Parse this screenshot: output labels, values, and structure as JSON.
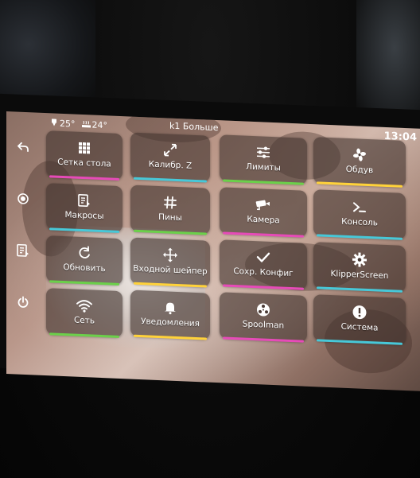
{
  "status": {
    "extruder_temp": "25°",
    "bed_temp": "24°",
    "title": "k1 Больше",
    "time": "13:04"
  },
  "colors": {
    "cyan": "#47c8d8",
    "green": "#6bd04a",
    "yellow": "#ffd23a",
    "magenta": "#e64bb8"
  },
  "sidebar": [
    {
      "name": "back-icon",
      "icon": "back"
    },
    {
      "name": "home-icon",
      "icon": "home"
    },
    {
      "name": "macro-shortcut-icon",
      "icon": "macro"
    },
    {
      "name": "power-icon",
      "icon": "power"
    }
  ],
  "tiles": [
    {
      "label": "Сетка стола",
      "icon": "grid",
      "color": "magenta"
    },
    {
      "label": "Калибр. Z",
      "icon": "z-calibrate",
      "color": "cyan"
    },
    {
      "label": "Лимиты",
      "icon": "sliders",
      "color": "green"
    },
    {
      "label": "Обдув",
      "icon": "fan",
      "color": "yellow"
    },
    {
      "label": "Макросы",
      "icon": "macro",
      "color": "cyan"
    },
    {
      "label": "Пины",
      "icon": "hash",
      "color": "green"
    },
    {
      "label": "Камера",
      "icon": "camera",
      "color": "magenta"
    },
    {
      "label": "Консоль",
      "icon": "console",
      "color": "cyan"
    },
    {
      "label": "Обновить",
      "icon": "refresh",
      "color": "green"
    },
    {
      "label": "Входной шейпер",
      "icon": "move",
      "color": "yellow"
    },
    {
      "label": "Сохр. Конфиг",
      "icon": "check",
      "color": "magenta"
    },
    {
      "label": "KlipperScreen",
      "icon": "gear",
      "color": "cyan"
    },
    {
      "label": "Сеть",
      "icon": "wifi",
      "color": "green"
    },
    {
      "label": "Уведомления",
      "icon": "bell",
      "color": "yellow"
    },
    {
      "label": "Spoolman",
      "icon": "spool",
      "color": "magenta"
    },
    {
      "label": "Система",
      "icon": "info",
      "color": "cyan"
    }
  ]
}
